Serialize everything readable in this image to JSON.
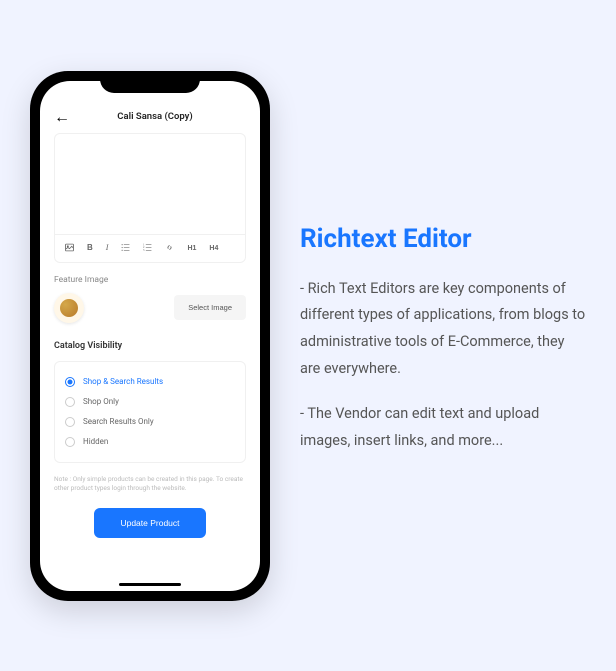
{
  "phone": {
    "title": "Cali Sansa (Copy)",
    "toolbar": {
      "h1": "H1",
      "h4": "H4"
    },
    "feature": {
      "label": "Feature Image",
      "button": "Select Image"
    },
    "catalog": {
      "title": "Catalog Visibility",
      "options": [
        {
          "label": "Shop & Search Results",
          "selected": true
        },
        {
          "label": "Shop Only",
          "selected": false
        },
        {
          "label": "Search Results Only",
          "selected": false
        },
        {
          "label": "Hidden",
          "selected": false
        }
      ]
    },
    "note": "Note : Only simple products can be created in this page. To create other product types login through the website.",
    "updateButton": "Update Product"
  },
  "info": {
    "title": "Richtext Editor",
    "p1": "- Rich Text Editors are key components of different types of applications, from blogs to administrative tools of E-Commerce, they are everywhere.",
    "p2": "- The Vendor can edit text and upload images, insert links, and more..."
  }
}
